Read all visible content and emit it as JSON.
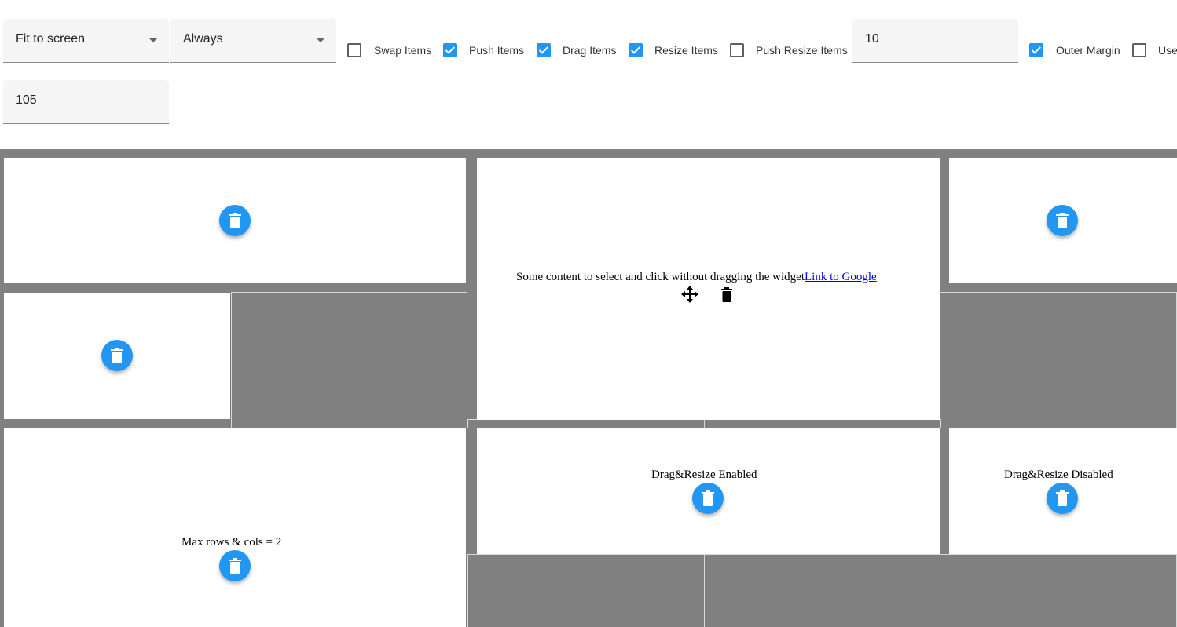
{
  "toolbar": {
    "grid_type": {
      "selected": "Fit to screen"
    },
    "compact_type": {
      "selected": "Always"
    },
    "checkboxes": [
      {
        "label": "Swap Items",
        "checked": false
      },
      {
        "label": "Push Items",
        "checked": true
      },
      {
        "label": "Drag Items",
        "checked": true
      },
      {
        "label": "Resize Items",
        "checked": true
      },
      {
        "label": "Push Resize Items",
        "checked": false
      },
      {
        "label": "Outer Margin",
        "checked": true
      },
      {
        "label": "Use",
        "checked": false
      }
    ],
    "margin_value": "10",
    "second_value": "105"
  },
  "widgets": {
    "content_widget": {
      "text": "Some content to select and click without dragging the widget",
      "link": "Link to Google",
      "drag_handle_icon": "move-icon",
      "delete_icon": "trash-icon"
    },
    "enabled_label": "Drag&Resize Enabled",
    "disabled_label": "Drag&Resize Disabled",
    "max_label": "Max rows & cols = 2"
  },
  "colors": {
    "accent": "#2196f3",
    "grid_background": "#808080",
    "widget_background": "#ffffff"
  }
}
